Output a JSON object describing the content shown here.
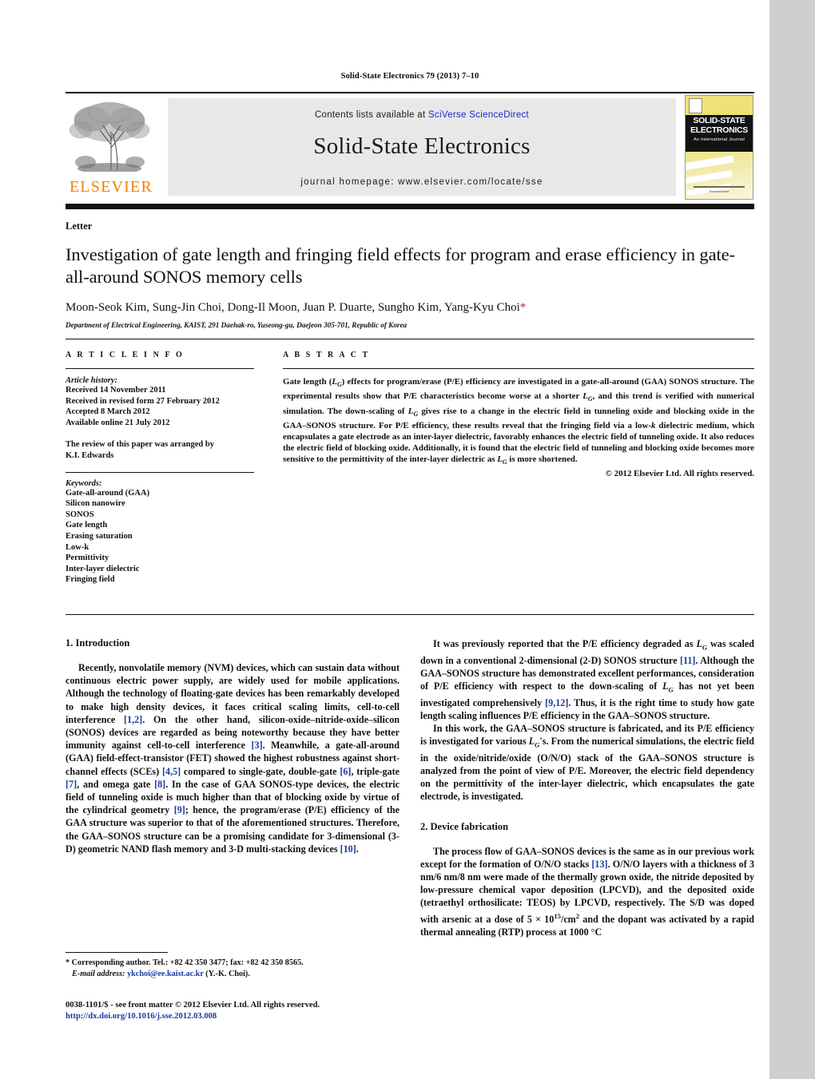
{
  "running_head": "Solid-State Electronics 79 (2013) 7–10",
  "masthead": {
    "publisher_name": "ELSEVIER",
    "contents_prefix": "Contents lists available at ",
    "contents_link": "SciVerse ScienceDirect",
    "journal_title": "Solid-State Electronics",
    "homepage": "journal homepage: www.elsevier.com/locate/sse",
    "cover": {
      "title_line1": "SOLID-STATE",
      "title_line2": "ELECTRONICS",
      "subtitle": "An International Journal",
      "footer_text": "ScienceDirect"
    }
  },
  "article": {
    "type": "Letter",
    "title": "Investigation of gate length and fringing field effects for program and erase efficiency in gate-all-around SONOS memory cells",
    "authors": "Moon-Seok Kim, Sung-Jin Choi, Dong-Il Moon, Juan P. Duarte, Sungho Kim, Yang-Kyu Choi",
    "corresponding_marker": "*",
    "affiliation": "Department of Electrical Engineering, KAIST, 291 Daehak-ro, Yuseong-gu, Daejeon 305-701, Republic of Korea"
  },
  "article_info": {
    "heading": "A R T I C L E   I N F O",
    "history_label": "Article history:",
    "history": [
      "Received 14 November 2011",
      "Received in revised form 27 February 2012",
      "Accepted 8 March 2012",
      "Available online 21 July 2012"
    ],
    "editor_note_line1": "The review of this paper was arranged by",
    "editor_note_line2": "K.I. Edwards",
    "keywords_label": "Keywords:",
    "keywords": [
      "Gate-all-around (GAA)",
      "Silicon nanowire",
      "SONOS",
      "Gate length",
      "Erasing saturation",
      "Low-k",
      "Permittivity",
      "Inter-layer dielectric",
      "Fringing field"
    ]
  },
  "abstract": {
    "heading": "A B S T R A C T",
    "copyright": "© 2012 Elsevier Ltd. All rights reserved."
  },
  "sections": {
    "introduction_heading": "1. Introduction",
    "device_fabrication_heading": "2. Device fabrication"
  },
  "footnote": {
    "corresponding": "Corresponding author. Tel.: +82 42 350 3477; fax: +82 42 350 8565.",
    "email_label": "E-mail address:",
    "email": "ykchoi@ee.kaist.ac.kr",
    "email_owner": "(Y.-K. Choi)."
  },
  "footer": {
    "issn_line": "0038-1101/$ - see front matter © 2012 Elsevier Ltd. All rights reserved.",
    "doi": "http://dx.doi.org/10.1016/j.sse.2012.03.008"
  }
}
